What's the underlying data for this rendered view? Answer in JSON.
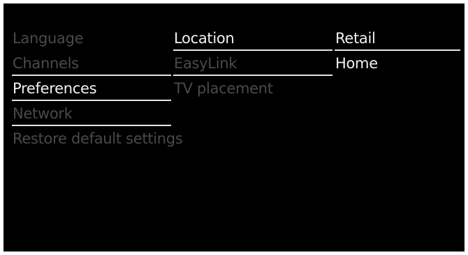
{
  "menu": {
    "column1": [
      {
        "label": "Language",
        "state": "dim"
      },
      {
        "label": "Channels",
        "state": "dim"
      },
      {
        "label": "Preferences",
        "state": "active"
      },
      {
        "label": "Network",
        "state": "dim"
      },
      {
        "label": "Restore default settings",
        "state": "dim"
      }
    ],
    "column2": [
      {
        "label": "Location",
        "state": "active"
      },
      {
        "label": "EasyLink",
        "state": "dim"
      },
      {
        "label": "TV placement",
        "state": "dim"
      }
    ],
    "column3": [
      {
        "label": "Retail",
        "state": "option"
      },
      {
        "label": "Home",
        "state": "option"
      }
    ]
  },
  "colors": {
    "background": "#000000",
    "text_active": "#f2f2f2",
    "text_dim": "#4a4a4a",
    "rule": "#e6e6e6"
  }
}
